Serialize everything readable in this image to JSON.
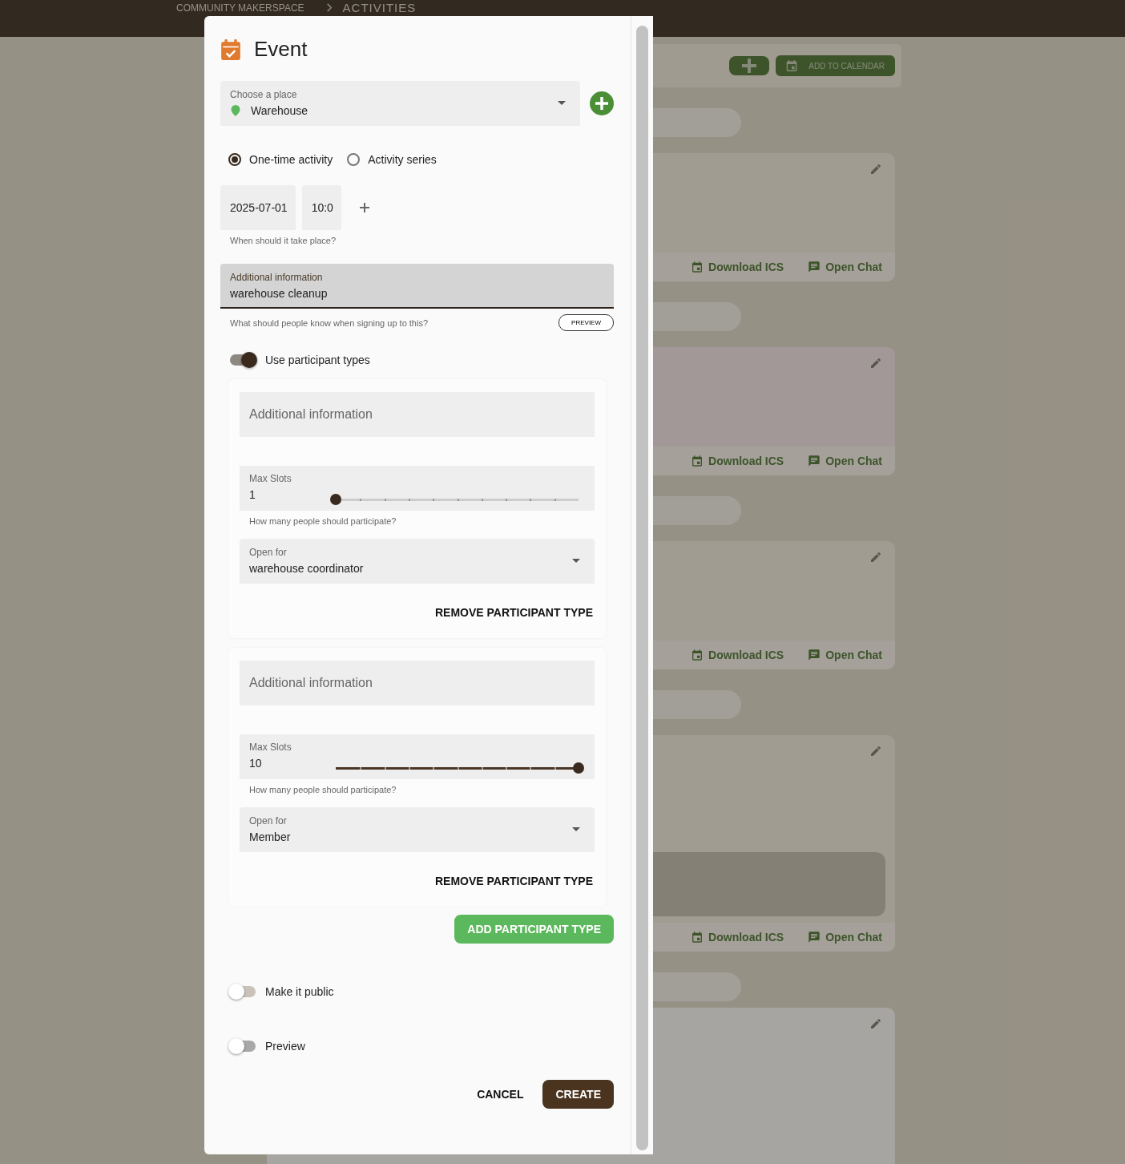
{
  "header": {
    "breadcrumb": [
      "COMMUNITY MAKERSPACE",
      "ACTIVITIES"
    ]
  },
  "toolbar": {
    "calendar_button": "ADD TO CALENDAR"
  },
  "activity_cards": [
    {
      "kind": "plain",
      "actions": [
        "Download ICS",
        "Open Chat"
      ]
    },
    {
      "kind": "plain",
      "actions": [
        "Download ICS",
        "Open Chat"
      ]
    },
    {
      "kind": "plain",
      "actions": [
        "Download ICS",
        "Open Chat"
      ]
    },
    {
      "kind": "boxed",
      "actions": [
        "Download ICS",
        "Open Chat"
      ]
    },
    {
      "kind": "partial"
    }
  ],
  "dialog": {
    "title": "Event",
    "place": {
      "label": "Choose a place",
      "value": "Warehouse"
    },
    "schedule_options": [
      {
        "label": "One-time activity",
        "selected": true
      },
      {
        "label": "Activity series",
        "selected": false
      }
    ],
    "date": "2025-07-01",
    "time": "10:0",
    "date_hint": "When should it take place?",
    "info": {
      "label": "Additional information",
      "value": "warehouse cleanup",
      "hint": "What should people know when signing up to this?"
    },
    "preview_button": "PREVIEW",
    "participant_toggle": {
      "label": "Use participant types",
      "on": true
    },
    "participant_types": [
      {
        "info_placeholder": "Additional information",
        "slots_label": "Max Slots",
        "slots_value": "1",
        "level": 0,
        "slots_hint": "How many people should participate?",
        "open_for_label": "Open for",
        "open_for_value": "warehouse coordinator",
        "remove_button": "REMOVE PARTICIPANT TYPE"
      },
      {
        "info_placeholder": "Additional information",
        "slots_label": "Max Slots",
        "slots_value": "10",
        "level": 1,
        "slots_hint": "How many people should participate?",
        "open_for_label": "Open for",
        "open_for_value": "Member",
        "remove_button": "REMOVE PARTICIPANT TYPE"
      }
    ],
    "add_type_button": "ADD PARTICIPANT TYPE",
    "toggles": [
      {
        "label": "Make it public",
        "on": false
      },
      {
        "label": "Preview",
        "on": false
      }
    ],
    "cancel_button": "CANCEL",
    "create_button": "CREATE"
  }
}
